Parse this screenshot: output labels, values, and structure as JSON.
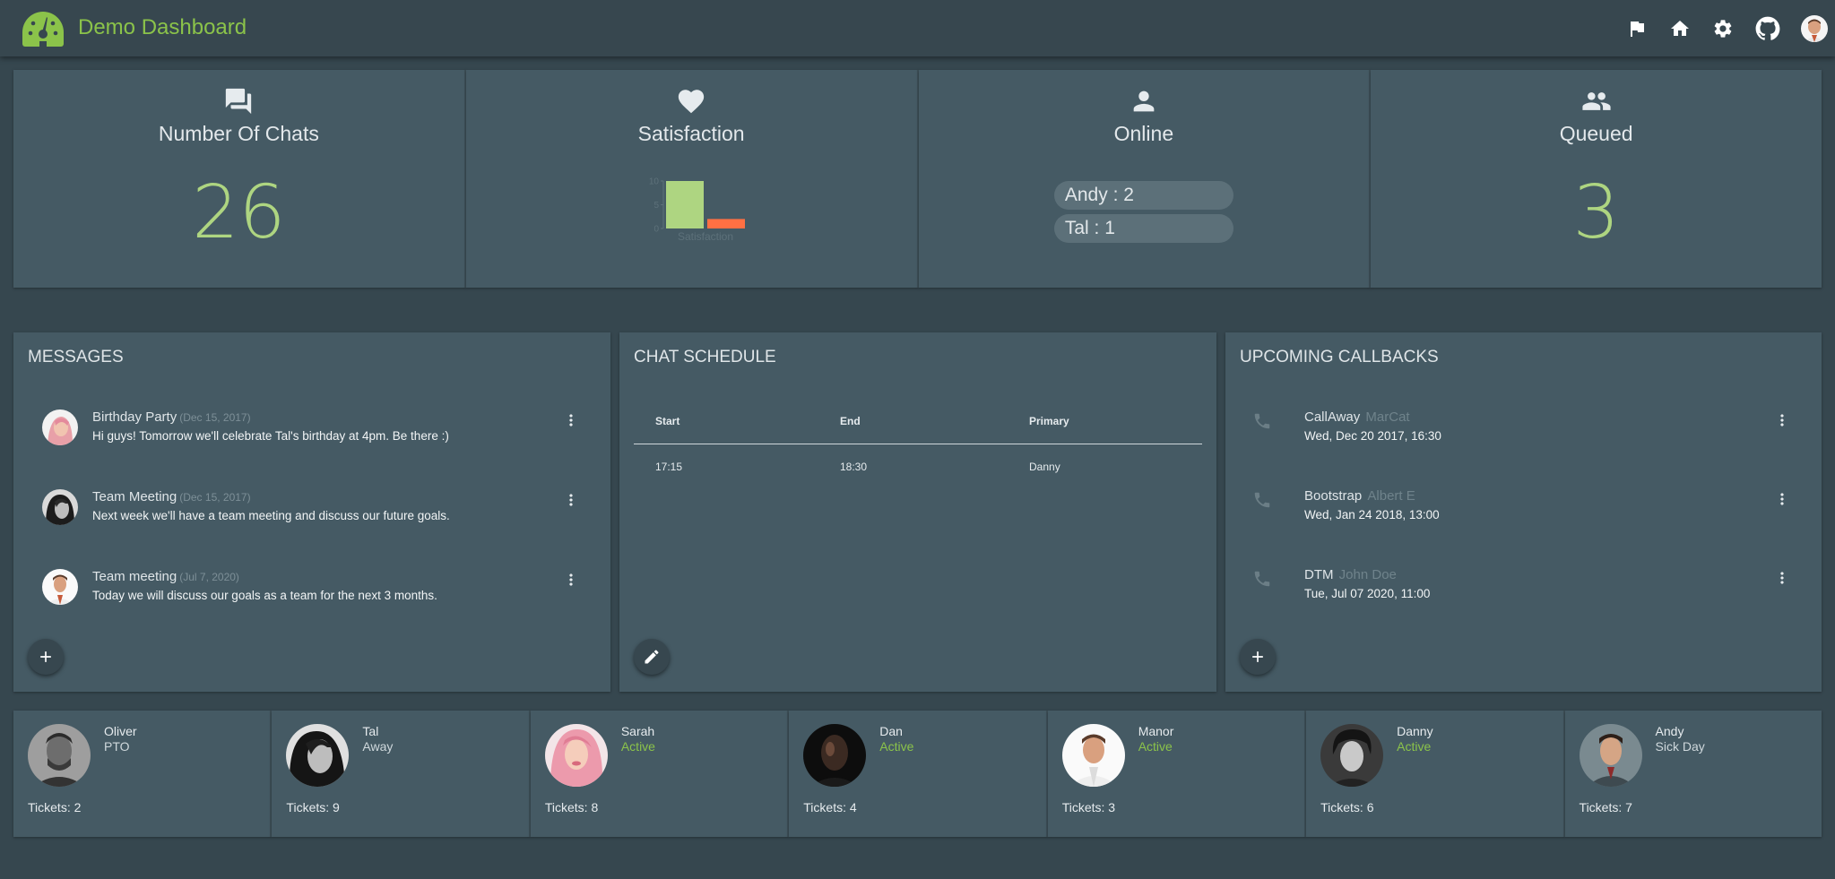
{
  "app": {
    "title": "Demo Dashboard",
    "accent": "#8bc34a"
  },
  "header": {
    "icons": [
      "flag-icon",
      "home-icon",
      "gear-icon",
      "github-icon",
      "user-avatar"
    ]
  },
  "stats": {
    "chats": {
      "label": "Number Of Chats",
      "value": "26",
      "icon": "chat-icon"
    },
    "satisfaction": {
      "label": "Satisfaction",
      "icon": "heart-icon"
    },
    "online": {
      "label": "Online",
      "icon": "person-icon",
      "agents": [
        "Andy : 2",
        "Tal : 1"
      ]
    },
    "queued": {
      "label": "Queued",
      "value": "3",
      "icon": "group-icon"
    }
  },
  "chart_data": {
    "type": "bar",
    "categories": [
      "Satisfaction"
    ],
    "series": [
      {
        "values": [
          10
        ],
        "color": "#aed581"
      },
      {
        "values": [
          2
        ],
        "color": "#ff7043"
      }
    ],
    "yticks": [
      "0",
      "5",
      "10"
    ],
    "ylim": [
      0,
      10
    ],
    "xlabel": "Satisfaction"
  },
  "messages": {
    "title": "MESSAGES",
    "items": [
      {
        "title": "Birthday Party",
        "date": "(Dec 15, 2017)",
        "text": "Hi guys! Tomorrow we'll celebrate Tal's birthday at 4pm. Be there :)"
      },
      {
        "title": "Team Meeting",
        "date": "(Dec 15, 2017)",
        "text": "Next week we'll have a team meeting and discuss our future goals."
      },
      {
        "title": "Team meeting",
        "date": "(Jul 7, 2020)",
        "text": "Today we will discuss our goals as a team for the next 3 months."
      }
    ]
  },
  "schedule": {
    "title": "CHAT SCHEDULE",
    "columns": [
      "Start",
      "End",
      "Primary"
    ],
    "rows": [
      [
        "17:15",
        "18:30",
        "Danny"
      ]
    ]
  },
  "callbacks": {
    "title": "UPCOMING CALLBACKS",
    "items": [
      {
        "name": "CallAway",
        "person": "MarCat",
        "when": "Wed, Dec 20 2017, 16:30"
      },
      {
        "name": "Bootstrap",
        "person": "Albert E",
        "when": "Wed, Jan 24 2018, 13:00"
      },
      {
        "name": "DTM",
        "person": "John Doe",
        "when": "Tue, Jul 07 2020, 11:00"
      }
    ]
  },
  "team": [
    {
      "name": "Oliver",
      "status": "PTO",
      "tickets": "Tickets: 2"
    },
    {
      "name": "Tal",
      "status": "Away",
      "tickets": "Tickets: 9"
    },
    {
      "name": "Sarah",
      "status": "Active",
      "tickets": "Tickets: 8"
    },
    {
      "name": "Dan",
      "status": "Active",
      "tickets": "Tickets: 4"
    },
    {
      "name": "Manor",
      "status": "Active",
      "tickets": "Tickets: 3"
    },
    {
      "name": "Danny",
      "status": "Active",
      "tickets": "Tickets: 6"
    },
    {
      "name": "Andy",
      "status": "Sick Day",
      "tickets": "Tickets: 7"
    }
  ]
}
